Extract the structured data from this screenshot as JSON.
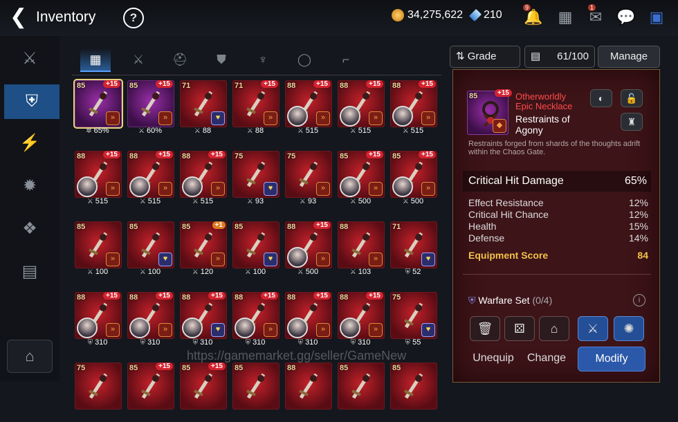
{
  "header": {
    "title": "Inventory",
    "back_icon": "back-arrow-icon",
    "help_icon": "question-icon",
    "gold": "34,275,622",
    "crystals": "210",
    "icons": [
      "bell-icon",
      "shop-icon",
      "mail-icon",
      "chat-icon",
      "grid-icon"
    ],
    "badges": {
      "bell": "9",
      "mail": "1"
    }
  },
  "sidebar": {
    "items": [
      "equipment-icon",
      "artifact-icon",
      "lightning-icon",
      "rune-icon",
      "materials-icon",
      "chest-icon"
    ],
    "active_index": 1,
    "bottom_icon": "storage-icon"
  },
  "tabs": [
    "grid-icon",
    "sword-icon",
    "helmet-icon",
    "armor-icon",
    "necklace-icon",
    "ring-icon",
    "boots-icon"
  ],
  "filter": {
    "sort_label": "Grade",
    "capacity": "61/100",
    "manage": "Manage"
  },
  "items": [
    {
      "level": "85",
      "enhance": "+15",
      "stat_icon": "gear",
      "stat": "65%",
      "purple": true,
      "set": "orange",
      "selected": true
    },
    {
      "level": "85",
      "enhance": "+15",
      "stat_icon": "sword",
      "stat": "60%",
      "purple": true,
      "set": "orange"
    },
    {
      "level": "71",
      "enhance": "",
      "stat_icon": "sword",
      "stat": "88",
      "set": "blue"
    },
    {
      "level": "71",
      "enhance": "+15",
      "stat_icon": "sword",
      "stat": "88",
      "set": "orange"
    },
    {
      "level": "88",
      "enhance": "+15",
      "stat_icon": "sword",
      "stat": "515",
      "set": "orange",
      "hero": true
    },
    {
      "level": "88",
      "enhance": "+15",
      "stat_icon": "sword",
      "stat": "515",
      "set": "orange",
      "hero": true
    },
    {
      "level": "88",
      "enhance": "+15",
      "stat_icon": "sword",
      "stat": "515",
      "set": "orange",
      "hero": true
    },
    {
      "level": "88",
      "enhance": "+15",
      "stat_icon": "sword",
      "stat": "515",
      "set": "orange",
      "hero": true
    },
    {
      "level": "88",
      "enhance": "+15",
      "stat_icon": "sword",
      "stat": "515",
      "set": "orange",
      "hero": true
    },
    {
      "level": "88",
      "enhance": "+15",
      "stat_icon": "sword",
      "stat": "515",
      "set": "orange",
      "hero": true
    },
    {
      "level": "75",
      "enhance": "",
      "stat_icon": "sword",
      "stat": "93",
      "set": "blue"
    },
    {
      "level": "75",
      "enhance": "",
      "stat_icon": "sword",
      "stat": "93",
      "set": "orange"
    },
    {
      "level": "85",
      "enhance": "+15",
      "stat_icon": "sword",
      "stat": "500",
      "set": "orange",
      "hero": true
    },
    {
      "level": "85",
      "enhance": "+15",
      "stat_icon": "sword",
      "stat": "500",
      "set": "orange",
      "hero": true
    },
    {
      "level": "85",
      "enhance": "",
      "stat_icon": "sword",
      "stat": "100",
      "set": "orange"
    },
    {
      "level": "85",
      "enhance": "",
      "stat_icon": "sword",
      "stat": "100",
      "set": "blue"
    },
    {
      "level": "85",
      "enhance": "+1",
      "stat_icon": "sword",
      "stat": "120",
      "set": "orange",
      "orange_enh": true
    },
    {
      "level": "85",
      "enhance": "",
      "stat_icon": "sword",
      "stat": "100",
      "set": "blue"
    },
    {
      "level": "88",
      "enhance": "+15",
      "stat_icon": "sword",
      "stat": "500",
      "set": "orange",
      "hero": true
    },
    {
      "level": "88",
      "enhance": "",
      "stat_icon": "sword",
      "stat": "103",
      "set": "orange"
    },
    {
      "level": "71",
      "enhance": "",
      "stat_icon": "shield",
      "stat": "52",
      "set": "blue"
    },
    {
      "level": "88",
      "enhance": "+15",
      "stat_icon": "shield",
      "stat": "310",
      "set": "orange",
      "hero": true
    },
    {
      "level": "88",
      "enhance": "+15",
      "stat_icon": "shield",
      "stat": "310",
      "set": "orange",
      "hero": true
    },
    {
      "level": "88",
      "enhance": "+15",
      "stat_icon": "shield",
      "stat": "310",
      "set": "blue",
      "hero": true
    },
    {
      "level": "88",
      "enhance": "+15",
      "stat_icon": "shield",
      "stat": "310",
      "set": "orange",
      "hero": true
    },
    {
      "level": "88",
      "enhance": "+15",
      "stat_icon": "shield",
      "stat": "310",
      "set": "orange",
      "hero": true
    },
    {
      "level": "88",
      "enhance": "+15",
      "stat_icon": "shield",
      "stat": "310",
      "set": "orange",
      "hero": true
    },
    {
      "level": "75",
      "enhance": "",
      "stat_icon": "shield",
      "stat": "55",
      "set": "blue"
    },
    {
      "level": "75",
      "enhance": "",
      "stat_icon": "",
      "stat": "",
      "set": ""
    },
    {
      "level": "85",
      "enhance": "+15",
      "stat_icon": "",
      "stat": "",
      "set": ""
    },
    {
      "level": "85",
      "enhance": "+15",
      "stat_icon": "",
      "stat": "",
      "set": ""
    },
    {
      "level": "85",
      "enhance": "",
      "stat_icon": "",
      "stat": "",
      "set": ""
    },
    {
      "level": "88",
      "enhance": "",
      "stat_icon": "",
      "stat": "",
      "set": ""
    },
    {
      "level": "85",
      "enhance": "",
      "stat_icon": "",
      "stat": "",
      "set": ""
    },
    {
      "level": "85",
      "enhance": "",
      "stat_icon": "",
      "stat": "",
      "set": ""
    }
  ],
  "panel": {
    "level": "85",
    "enhance": "+15",
    "name_line1": "Otherworldly Epic Necklace",
    "name_line2": "Restraints of Agony",
    "description": "Restraints forged from shards of the thoughts adrift within the Chaos Gate.",
    "main_stat": {
      "name": "Critical Hit Damage",
      "value": "65%"
    },
    "sub_stats": [
      {
        "name": "Effect Resistance",
        "value": "12%"
      },
      {
        "name": "Critical Hit Chance",
        "value": "12%"
      },
      {
        "name": "Health",
        "value": "15%"
      },
      {
        "name": "Defense",
        "value": "14%"
      }
    ],
    "score": {
      "name": "Equipment Score",
      "value": "84"
    },
    "set": {
      "name": "Warfare Set",
      "count": "(0/4)"
    },
    "actions": [
      "trash-icon",
      "dice-icon",
      "storage-icon",
      "sword-blue-icon",
      "burst-blue-icon"
    ],
    "buttons": {
      "unequip": "Unequip",
      "change": "Change",
      "modify": "Modify"
    }
  },
  "watermark": "https://gamemarket.gg/seller/GameNew"
}
